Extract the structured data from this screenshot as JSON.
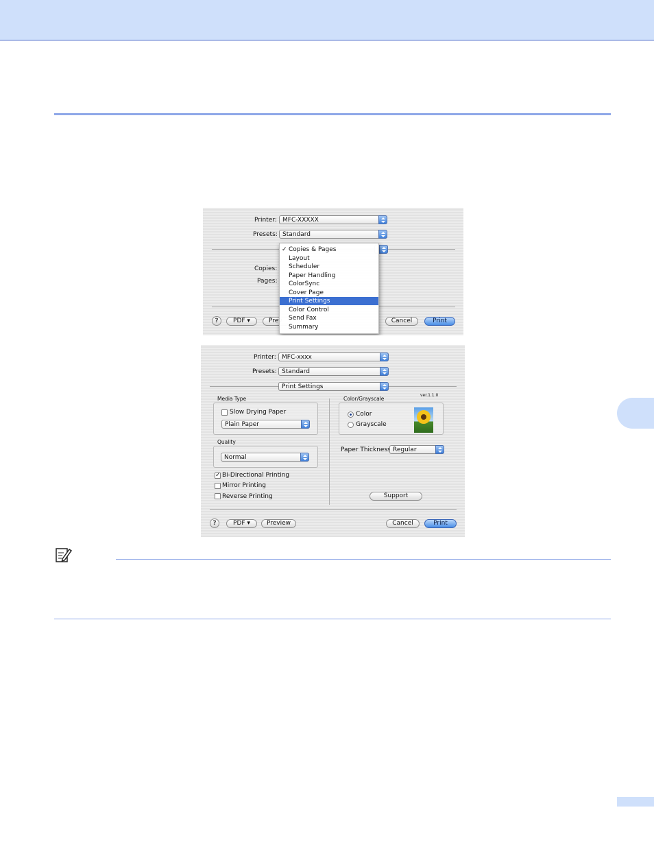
{
  "dialog1": {
    "printer_label": "Printer:",
    "printer_value": "MFC-XXXXX",
    "presets_label": "Presets:",
    "presets_value": "Standard",
    "copies_label": "Copies:",
    "pages_label": "Pages:",
    "menu_items": [
      {
        "label": "Copies & Pages",
        "checked": true,
        "selected": false
      },
      {
        "label": "Layout",
        "checked": false,
        "selected": false
      },
      {
        "label": "Scheduler",
        "checked": false,
        "selected": false
      },
      {
        "label": "Paper Handling",
        "checked": false,
        "selected": false
      },
      {
        "label": "ColorSync",
        "checked": false,
        "selected": false
      },
      {
        "label": "Cover Page",
        "checked": false,
        "selected": false
      },
      {
        "label": "Print Settings",
        "checked": false,
        "selected": true
      },
      {
        "label": "Color Control",
        "checked": false,
        "selected": false
      },
      {
        "label": "Send Fax",
        "checked": false,
        "selected": false
      },
      {
        "label": "Summary",
        "checked": false,
        "selected": false
      }
    ],
    "check_mark": "✓",
    "help_label": "?",
    "pdf_label": "PDF ▾",
    "preview_label": "Prev",
    "cancel_label": "Cancel",
    "print_label": "Print"
  },
  "dialog2": {
    "printer_label": "Printer:",
    "printer_value": "MFC-xxxx",
    "presets_label": "Presets:",
    "presets_value": "Standard",
    "panel_value": "Print Settings",
    "media_type_label": "Media Type",
    "slow_drying_label": "Slow Drying Paper",
    "slow_drying_checked": false,
    "media_value": "Plain Paper",
    "quality_label": "Quality",
    "quality_value": "Normal",
    "bidirectional_label": "Bi-Directional Printing",
    "bidirectional_checked": true,
    "mirror_label": "Mirror Printing",
    "mirror_checked": false,
    "reverse_label": "Reverse Printing",
    "reverse_checked": false,
    "color_grayscale_label": "Color/Grayscale",
    "version_label": "ver.1.1.0",
    "color_label": "Color",
    "grayscale_label": "Grayscale",
    "color_selected": "Color",
    "paper_thickness_label": "Paper Thickness:",
    "paper_thickness_value": "Regular",
    "support_label": "Support",
    "help_label": "?",
    "pdf_label": "PDF ▾",
    "preview_label": "Preview",
    "cancel_label": "Cancel",
    "print_label": "Print"
  },
  "colors": {
    "header_band": "#cfe0fb",
    "rule": "#8fa8e8",
    "menu_highlight": "#3b6fd1",
    "aqua_button": "#4a8ee6"
  }
}
